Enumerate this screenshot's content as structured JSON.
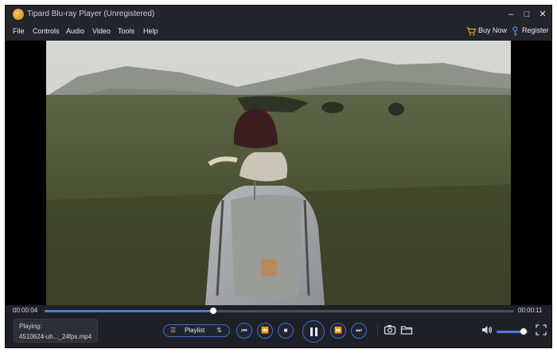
{
  "app": {
    "title": "Tipard Blu-ray Player (Unregistered)"
  },
  "window_controls": {
    "minimize": "–",
    "maximize": "□",
    "close": "✕"
  },
  "menu": {
    "items": [
      "File",
      "Controls",
      "Audio",
      "Video",
      "Tools",
      "Help"
    ],
    "buy_now": "Buy Now",
    "register": "Register"
  },
  "player": {
    "current_time": "00:00:04",
    "total_time": "00:00:11",
    "progress": 0.36,
    "playing_label": "Playing:",
    "file_name": "4510624-uh..._24fps.mp4",
    "playlist_label": "Playlist",
    "volume": 0.85
  },
  "colors": {
    "accent": "#4a7dd8",
    "background": "#1e2026",
    "button_border": "#3c6fd0"
  },
  "icons": {
    "logo": "tipard-logo-icon",
    "buy": "cart-icon",
    "register": "key-icon",
    "controls": [
      "list-icon",
      "playlist-order-icon",
      "previous-icon",
      "rewind-icon",
      "stop-icon",
      "pause-icon",
      "fast-forward-icon",
      "next-icon",
      "camera-icon",
      "folder-icon",
      "volume-icon",
      "fullscreen-icon"
    ]
  }
}
